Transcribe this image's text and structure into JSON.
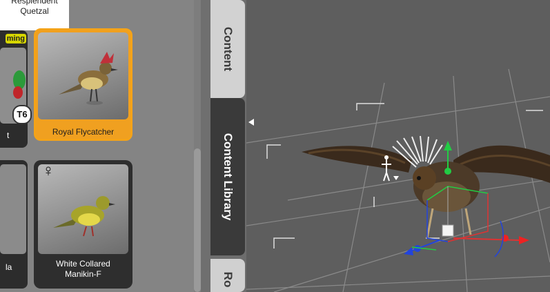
{
  "content_library": {
    "cards": [
      {
        "name": "Resplendent Quetzal",
        "label": "Resplendent\nQuetzal"
      },
      {
        "name": "Royal Flycatcher",
        "label": "Royal Flycatcher",
        "selected": true
      },
      {
        "name": "White Collared Manikin-F",
        "label": "White Collared\nManikin-F",
        "badge": "♀"
      }
    ],
    "partial_labels": {
      "left_top": "ming",
      "left_mid": "t",
      "left_bottom": "la",
      "t6": "T6"
    }
  },
  "tabs": [
    {
      "label": "Content"
    },
    {
      "label": "Content Library",
      "active": true
    },
    {
      "label": "Ro"
    }
  ],
  "colors": {
    "selected": "#f4a318",
    "panel": "#848484",
    "viewport": "#5e5e5e",
    "card": "#2e2e2e"
  },
  "viewport": {
    "gizmo_axes": [
      "x",
      "y",
      "z"
    ]
  }
}
